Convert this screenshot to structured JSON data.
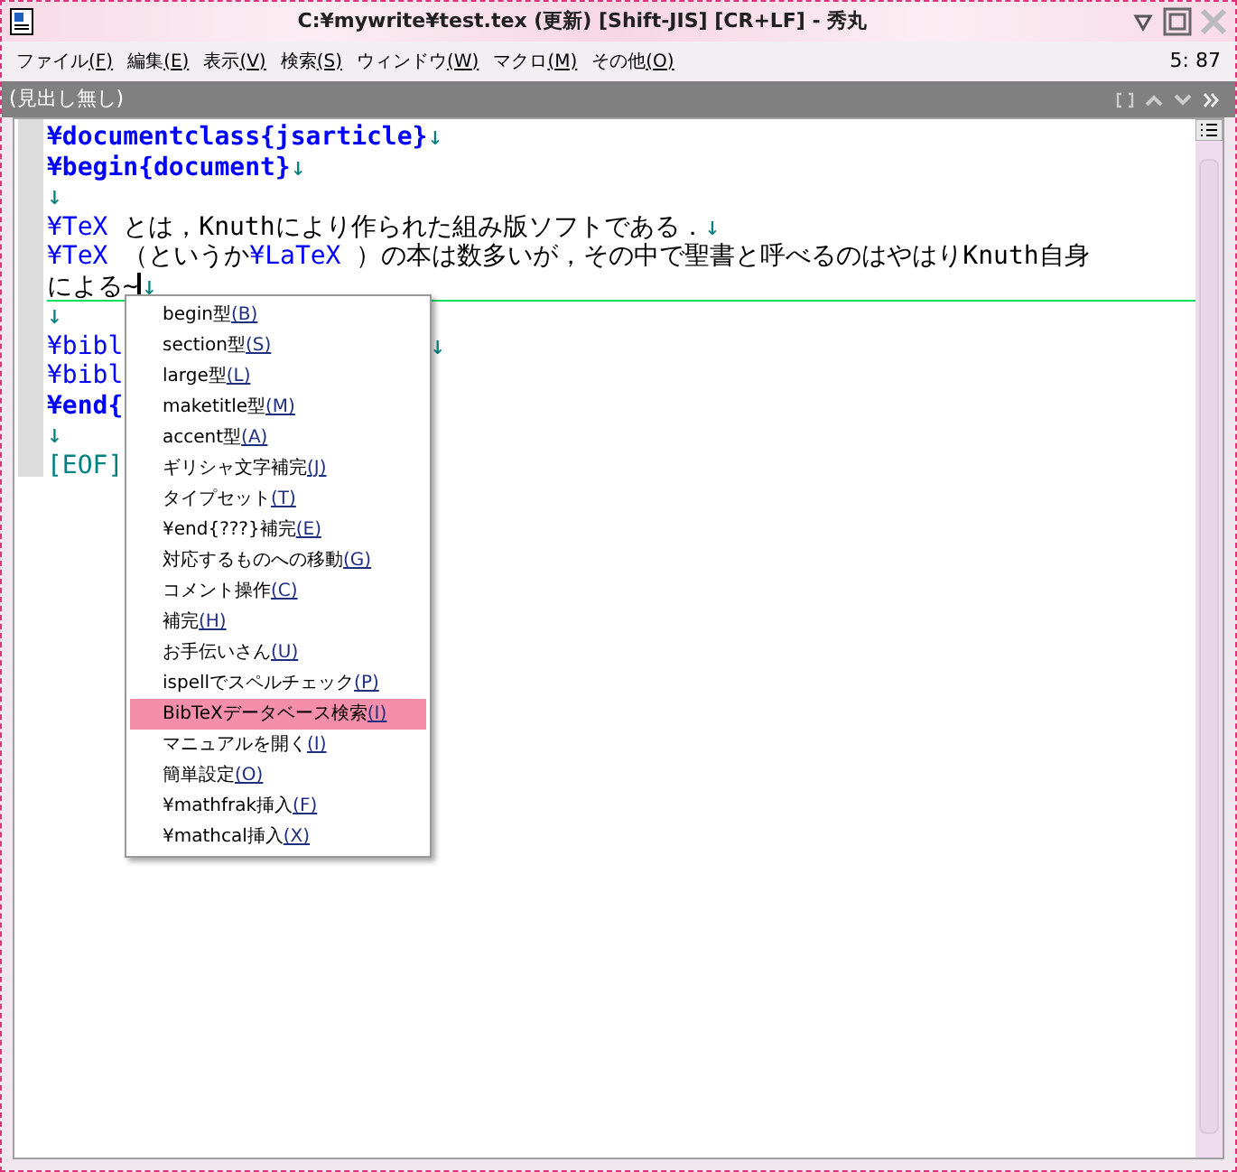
{
  "window": {
    "title": "C:¥mywrite¥test.tex (更新) [Shift-JIS] [CR+LF] - 秀丸"
  },
  "menu_bar": [
    {
      "label": "ファイル",
      "accel": "(F)"
    },
    {
      "label": "編集",
      "accel": "(E)"
    },
    {
      "label": "表示",
      "accel": "(V)"
    },
    {
      "label": "検索",
      "accel": "(S)"
    },
    {
      "label": "ウィンドウ",
      "accel": "(W)"
    },
    {
      "label": "マクロ",
      "accel": "(M)"
    },
    {
      "label": "その他",
      "accel": "(O)"
    }
  ],
  "cursor_position": "5: 87",
  "heading_bar": {
    "title": "(見出し無し)"
  },
  "editor": {
    "lines": [
      {
        "current": false,
        "segments": [
          {
            "kind": "bold_command",
            "text": "¥documentclass{jsarticle}"
          },
          {
            "kind": "mark",
            "text": "↓"
          }
        ]
      },
      {
        "current": false,
        "segments": [
          {
            "kind": "bold_command",
            "text": "¥begin{document}"
          },
          {
            "kind": "mark",
            "text": "↓"
          }
        ]
      },
      {
        "current": false,
        "segments": [
          {
            "kind": "mark",
            "text": "↓"
          }
        ]
      },
      {
        "current": false,
        "segments": [
          {
            "kind": "command",
            "text": "¥TeX"
          },
          {
            "kind": "text",
            "text": " とは，Knuthにより作られた組み版ソフトである．"
          },
          {
            "kind": "mark",
            "text": "↓"
          }
        ]
      },
      {
        "current": false,
        "segments": [
          {
            "kind": "command",
            "text": "¥TeX"
          },
          {
            "kind": "text",
            "text": " （というか"
          },
          {
            "kind": "command",
            "text": "¥LaTeX"
          },
          {
            "kind": "text",
            "text": " ）の本は数多いが，その中で聖書と呼べるのはやはりKnuth自身"
          }
        ]
      },
      {
        "current": true,
        "segments": [
          {
            "kind": "text",
            "text": "による~"
          },
          {
            "kind": "cursor"
          },
          {
            "kind": "mark",
            "text": "↓"
          }
        ]
      },
      {
        "current": false,
        "segments": [
          {
            "kind": "mark",
            "text": "↓"
          }
        ]
      },
      {
        "current": false,
        "segments": [
          {
            "kind": "command",
            "text": "¥bibl"
          },
          {
            "kind": "gap"
          },
          {
            "kind": "mark",
            "text": "↓"
          }
        ]
      },
      {
        "current": false,
        "segments": [
          {
            "kind": "command",
            "text": "¥bibl"
          }
        ]
      },
      {
        "current": false,
        "segments": [
          {
            "kind": "bold_command",
            "text": "¥end{"
          }
        ]
      },
      {
        "current": false,
        "segments": [
          {
            "kind": "mark",
            "text": "↓"
          }
        ]
      },
      {
        "current": false,
        "segments": [
          {
            "kind": "eof",
            "text": "[EOF]"
          }
        ]
      }
    ]
  },
  "context_menu": [
    {
      "label": "begin型",
      "accel": "(B)",
      "selected": false
    },
    {
      "label": "section型",
      "accel": "(S)",
      "selected": false
    },
    {
      "label": "large型",
      "accel": "(L)",
      "selected": false
    },
    {
      "label": "maketitle型",
      "accel": "(M)",
      "selected": false
    },
    {
      "label": "accent型",
      "accel": "(A)",
      "selected": false
    },
    {
      "label": "ギリシャ文字補完",
      "accel": "(J)",
      "selected": false
    },
    {
      "label": "タイプセット",
      "accel": "(T)",
      "selected": false
    },
    {
      "label": "¥end{???}補完",
      "accel": "(E)",
      "selected": false
    },
    {
      "label": "対応するものへの移動",
      "accel": "(G)",
      "selected": false
    },
    {
      "label": "コメント操作",
      "accel": "(C)",
      "selected": false
    },
    {
      "label": "補完",
      "accel": "(H)",
      "selected": false
    },
    {
      "label": "お手伝いさん",
      "accel": "(U)",
      "selected": false
    },
    {
      "label": "ispellでスペルチェック",
      "accel": "(P)",
      "selected": false
    },
    {
      "label": "BibTeXデータベース検索",
      "accel": "(I)",
      "selected": true
    },
    {
      "label": "マニュアルを開く",
      "accel": "(I)",
      "selected": false
    },
    {
      "label": "簡単設定",
      "accel": "(O)",
      "selected": false
    },
    {
      "label": "¥mathfrak挿入",
      "accel": "(F)",
      "selected": false
    },
    {
      "label": "¥mathcal挿入",
      "accel": "(X)",
      "selected": false
    }
  ]
}
